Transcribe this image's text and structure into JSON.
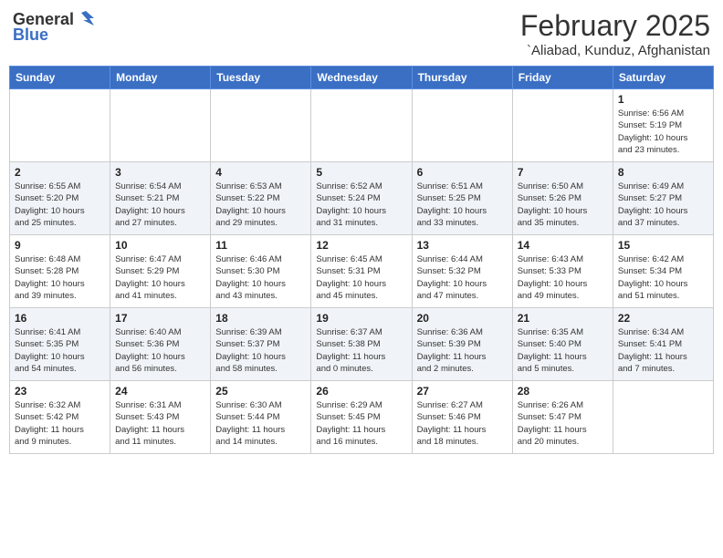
{
  "header": {
    "logo_general": "General",
    "logo_blue": "Blue",
    "month_title": "February 2025",
    "location": "`Aliabad, Kunduz, Afghanistan"
  },
  "days_of_week": [
    "Sunday",
    "Monday",
    "Tuesday",
    "Wednesday",
    "Thursday",
    "Friday",
    "Saturday"
  ],
  "weeks": [
    [
      {
        "day": "",
        "info": ""
      },
      {
        "day": "",
        "info": ""
      },
      {
        "day": "",
        "info": ""
      },
      {
        "day": "",
        "info": ""
      },
      {
        "day": "",
        "info": ""
      },
      {
        "day": "",
        "info": ""
      },
      {
        "day": "1",
        "info": "Sunrise: 6:56 AM\nSunset: 5:19 PM\nDaylight: 10 hours\nand 23 minutes."
      }
    ],
    [
      {
        "day": "2",
        "info": "Sunrise: 6:55 AM\nSunset: 5:20 PM\nDaylight: 10 hours\nand 25 minutes."
      },
      {
        "day": "3",
        "info": "Sunrise: 6:54 AM\nSunset: 5:21 PM\nDaylight: 10 hours\nand 27 minutes."
      },
      {
        "day": "4",
        "info": "Sunrise: 6:53 AM\nSunset: 5:22 PM\nDaylight: 10 hours\nand 29 minutes."
      },
      {
        "day": "5",
        "info": "Sunrise: 6:52 AM\nSunset: 5:24 PM\nDaylight: 10 hours\nand 31 minutes."
      },
      {
        "day": "6",
        "info": "Sunrise: 6:51 AM\nSunset: 5:25 PM\nDaylight: 10 hours\nand 33 minutes."
      },
      {
        "day": "7",
        "info": "Sunrise: 6:50 AM\nSunset: 5:26 PM\nDaylight: 10 hours\nand 35 minutes."
      },
      {
        "day": "8",
        "info": "Sunrise: 6:49 AM\nSunset: 5:27 PM\nDaylight: 10 hours\nand 37 minutes."
      }
    ],
    [
      {
        "day": "9",
        "info": "Sunrise: 6:48 AM\nSunset: 5:28 PM\nDaylight: 10 hours\nand 39 minutes."
      },
      {
        "day": "10",
        "info": "Sunrise: 6:47 AM\nSunset: 5:29 PM\nDaylight: 10 hours\nand 41 minutes."
      },
      {
        "day": "11",
        "info": "Sunrise: 6:46 AM\nSunset: 5:30 PM\nDaylight: 10 hours\nand 43 minutes."
      },
      {
        "day": "12",
        "info": "Sunrise: 6:45 AM\nSunset: 5:31 PM\nDaylight: 10 hours\nand 45 minutes."
      },
      {
        "day": "13",
        "info": "Sunrise: 6:44 AM\nSunset: 5:32 PM\nDaylight: 10 hours\nand 47 minutes."
      },
      {
        "day": "14",
        "info": "Sunrise: 6:43 AM\nSunset: 5:33 PM\nDaylight: 10 hours\nand 49 minutes."
      },
      {
        "day": "15",
        "info": "Sunrise: 6:42 AM\nSunset: 5:34 PM\nDaylight: 10 hours\nand 51 minutes."
      }
    ],
    [
      {
        "day": "16",
        "info": "Sunrise: 6:41 AM\nSunset: 5:35 PM\nDaylight: 10 hours\nand 54 minutes."
      },
      {
        "day": "17",
        "info": "Sunrise: 6:40 AM\nSunset: 5:36 PM\nDaylight: 10 hours\nand 56 minutes."
      },
      {
        "day": "18",
        "info": "Sunrise: 6:39 AM\nSunset: 5:37 PM\nDaylight: 10 hours\nand 58 minutes."
      },
      {
        "day": "19",
        "info": "Sunrise: 6:37 AM\nSunset: 5:38 PM\nDaylight: 11 hours\nand 0 minutes."
      },
      {
        "day": "20",
        "info": "Sunrise: 6:36 AM\nSunset: 5:39 PM\nDaylight: 11 hours\nand 2 minutes."
      },
      {
        "day": "21",
        "info": "Sunrise: 6:35 AM\nSunset: 5:40 PM\nDaylight: 11 hours\nand 5 minutes."
      },
      {
        "day": "22",
        "info": "Sunrise: 6:34 AM\nSunset: 5:41 PM\nDaylight: 11 hours\nand 7 minutes."
      }
    ],
    [
      {
        "day": "23",
        "info": "Sunrise: 6:32 AM\nSunset: 5:42 PM\nDaylight: 11 hours\nand 9 minutes."
      },
      {
        "day": "24",
        "info": "Sunrise: 6:31 AM\nSunset: 5:43 PM\nDaylight: 11 hours\nand 11 minutes."
      },
      {
        "day": "25",
        "info": "Sunrise: 6:30 AM\nSunset: 5:44 PM\nDaylight: 11 hours\nand 14 minutes."
      },
      {
        "day": "26",
        "info": "Sunrise: 6:29 AM\nSunset: 5:45 PM\nDaylight: 11 hours\nand 16 minutes."
      },
      {
        "day": "27",
        "info": "Sunrise: 6:27 AM\nSunset: 5:46 PM\nDaylight: 11 hours\nand 18 minutes."
      },
      {
        "day": "28",
        "info": "Sunrise: 6:26 AM\nSunset: 5:47 PM\nDaylight: 11 hours\nand 20 minutes."
      },
      {
        "day": "",
        "info": ""
      }
    ]
  ]
}
